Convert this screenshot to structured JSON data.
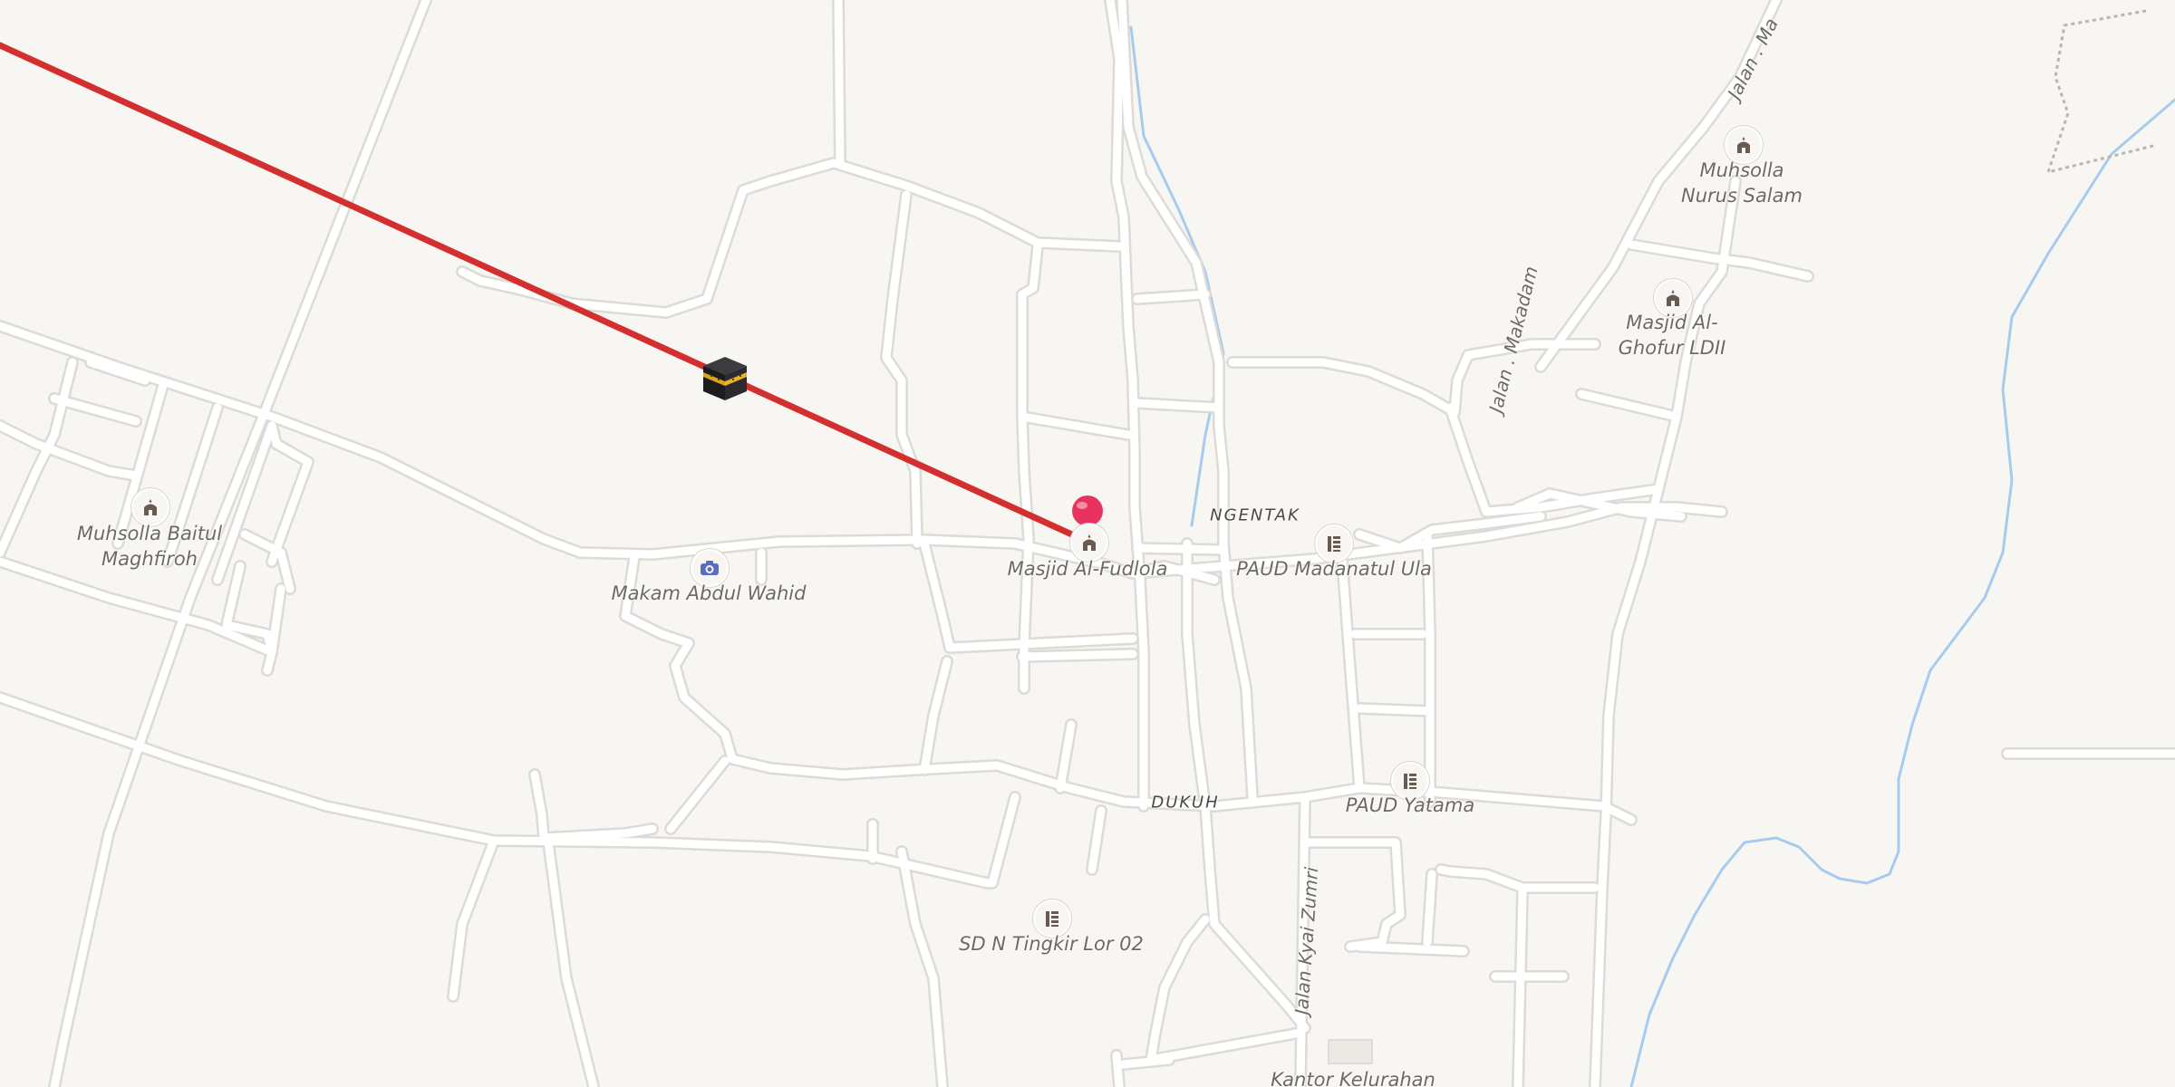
{
  "map": {
    "colors": {
      "background": "#f8f6f3",
      "road": "#ffffff",
      "road_casing": "#dedad5",
      "water": "#a7cbee",
      "qibla_line": "#d32f2f",
      "pin": "#e8335e",
      "boundary": "#b9b6b2"
    },
    "qibla": {
      "direction_icon": "kaaba-icon",
      "current_location_icon": "location-pin-icon"
    },
    "area_labels": {
      "ngentak": "NGENTAK",
      "dukuh": "DUKUH"
    },
    "street_labels": {
      "makadam": "Jalan . Makadam",
      "makadam_top": "Jalan . Ma",
      "kyai_zumri": "Jalan Kyai Zumri"
    },
    "pois": [
      {
        "icon": "mosque-icon",
        "name": "Muhsolla Baitul Maghfiroh"
      },
      {
        "icon": "camera-icon",
        "name": "Makam Abdul Wahid"
      },
      {
        "icon": "mosque-icon",
        "name": "Masjid Al-Fudlola"
      },
      {
        "icon": "school-icon",
        "name": "PAUD Madanatul Ula"
      },
      {
        "icon": "mosque-icon",
        "name": "Muhsolla Nurus Salam"
      },
      {
        "icon": "mosque-icon",
        "name": "Masjid Al-Ghofur LDII"
      },
      {
        "icon": "school-icon",
        "name": "PAUD Yatama"
      },
      {
        "icon": "school-icon",
        "name": "SD N Tingkir Lor 02"
      },
      {
        "icon": "building-icon",
        "name": "Kantor Kelurahan"
      }
    ]
  }
}
